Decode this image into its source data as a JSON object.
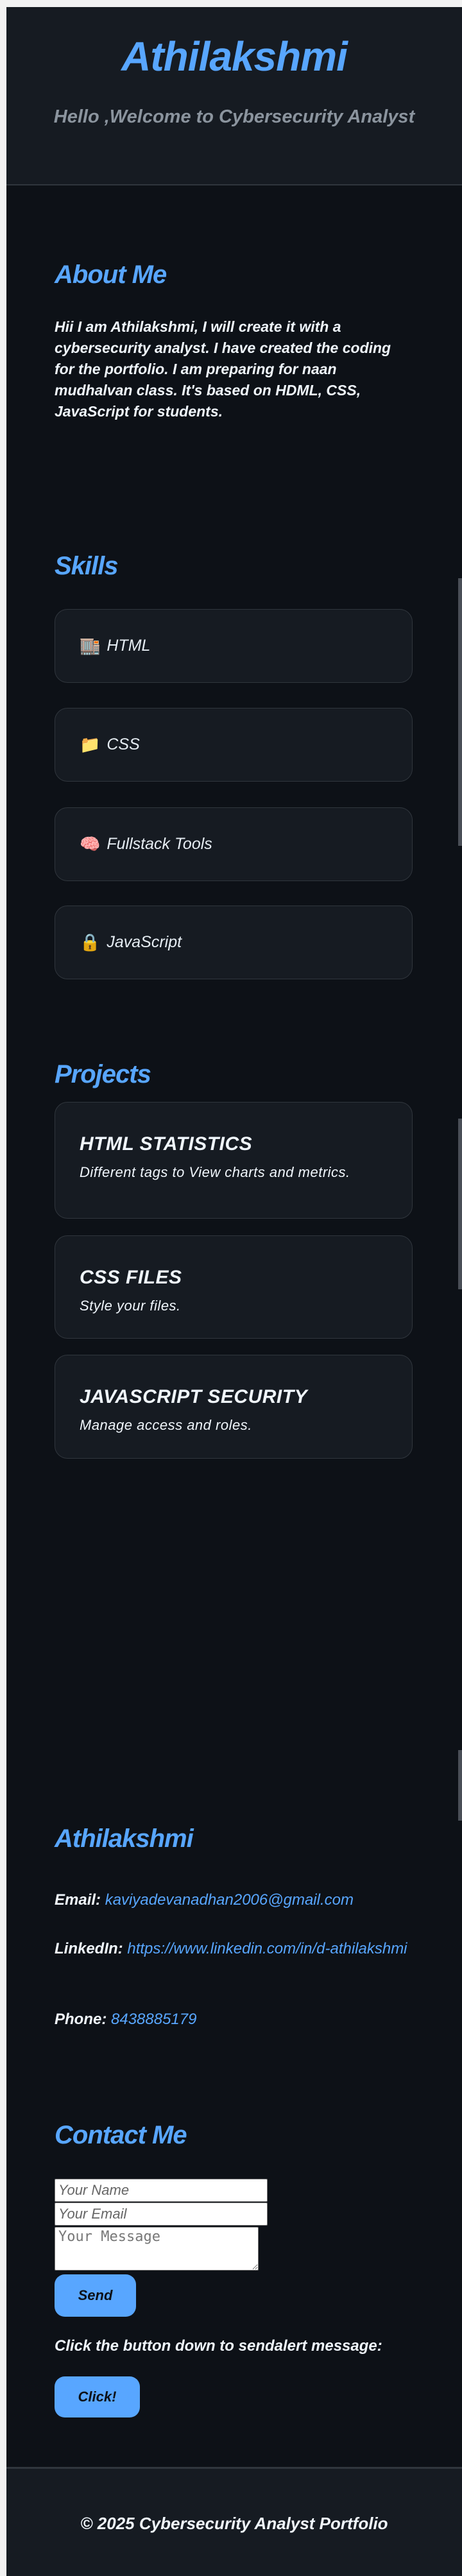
{
  "header": {
    "title": "Athilakshmi",
    "subtitle": "Hello ,Welcome to Cybersecurity Analyst"
  },
  "about": {
    "heading": "About Me",
    "text": "Hii I am Athilakshmi, I will create it with a cybersecurity analyst. I have created the coding for the portfolio. I am preparing for naan mudhalvan class. It's based on HDML, CSS, JavaScript for students."
  },
  "skills": {
    "heading": "Skills",
    "items": [
      {
        "icon": "🏬",
        "icon_name": "building-icon",
        "label": "HTML"
      },
      {
        "icon": "📁",
        "icon_name": "folder-icon",
        "label": "CSS"
      },
      {
        "icon": "🧠",
        "icon_name": "brain-icon",
        "label": "Fullstack Tools"
      },
      {
        "icon": "🔒",
        "icon_name": "lock-icon",
        "label": "JavaScript"
      }
    ]
  },
  "projects": {
    "heading": "Projects",
    "items": [
      {
        "title": "HTML STATISTICS",
        "desc": "Different tags to View charts and metrics."
      },
      {
        "title": "CSS FILES",
        "desc": "Style your files."
      },
      {
        "title": "JAVASCRIPT SECURITY",
        "desc": "Manage access and roles."
      }
    ]
  },
  "info": {
    "heading": "Athilakshmi",
    "email_label": "Email:",
    "email": "kaviyadevanadhan2006@gmail.com",
    "linkedin_label": "LinkedIn:",
    "linkedin": "https://www.linkedin.com/in/d-athilakshmi",
    "phone_label": "Phone:",
    "phone": "8438885179"
  },
  "contact": {
    "heading": "Contact Me",
    "name_placeholder": "Your Name",
    "email_placeholder": "Your Email",
    "message_placeholder": "Your Message",
    "send_label": "Send",
    "alert_text": "Click the button down to sendalert message:",
    "click_label": "Click!"
  },
  "footer": {
    "text": "© 2025 Cybersecurity Analyst Portfolio"
  },
  "colors": {
    "accent": "#58a6ff",
    "background": "#0d1117",
    "card": "#161b22"
  }
}
